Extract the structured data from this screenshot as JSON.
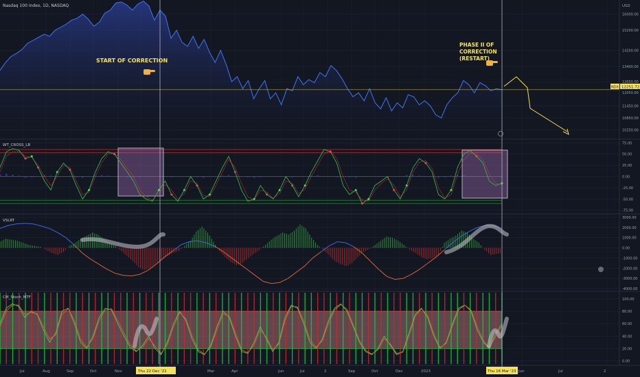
{
  "header": {
    "symbol_title": "Nasdaq 100 Index, 1D, NASDAQ",
    "currency": "USD"
  },
  "annotations": {
    "start": "START OF CORRECTION",
    "phase": [
      "PHASE II OF",
      "CORRECTION",
      "(RESTART)"
    ],
    "pointer_icon": "pointing-hand-icon"
  },
  "price_badge": {
    "ticker": "NDX",
    "value": "12251.72",
    "below": "12050.00"
  },
  "colors": {
    "bg": "#131722",
    "grid": "#1f2433",
    "price_line": "#3d6fe0",
    "price_fill_top": "#2c3f9a",
    "annotation": "#f5e25a",
    "wt_red": "#d23a3a",
    "wt_green": "#37b24d",
    "vslrt_green": "#2e9a3a",
    "vslrt_red": "#b02a2a",
    "stoch_band": "#c98a8a"
  },
  "panes": {
    "wt_title": "WT_CROSS_LB",
    "vslrt_title": "VSLRT",
    "stoch_title": "CM_Stoch_MTF"
  },
  "x_axis": {
    "labels": [
      "Jul",
      "Aug",
      "Sep",
      "Oct",
      "Nov",
      "Dec",
      "Mar",
      "Apr",
      "Jun",
      "Jul",
      "2",
      "Sep",
      "Oct",
      "Dec",
      "2023",
      "Jun",
      "Jul",
      "2"
    ],
    "cursor_left": "Thu 22 Dec '21",
    "cursor_right": "Thu 16 Mar '23"
  },
  "chart_data": [
    {
      "type": "area",
      "pane": "price",
      "y_ticks": [
        16000,
        15200,
        14200,
        13400,
        12650,
        11450,
        10850,
        10250
      ],
      "y_tick_labels": [
        "16000.00",
        "15200.00",
        "14200.00",
        "13400.00",
        "12650.00",
        "11450.00",
        "10850.00",
        "10250.00"
      ],
      "ylim": [
        9900,
        16700
      ],
      "hline": 12251.72,
      "series": [
        {
          "values": [
            13200,
            13600,
            13900,
            14050,
            14250,
            14550,
            14700,
            14850,
            15000,
            14900,
            15200,
            15350,
            15500,
            15700,
            15800,
            16000,
            15750,
            15400,
            15600,
            16050,
            16200,
            16550,
            16600,
            16450,
            16200,
            16500,
            16650,
            16400,
            15700,
            16200,
            15900,
            14800,
            15200,
            14600,
            14400,
            14900,
            14300,
            14750,
            14100,
            13600,
            14200,
            13500,
            12650,
            12900,
            12300,
            12700,
            11800,
            12300,
            12700,
            11800,
            12100,
            11500,
            12300,
            12200,
            12900,
            12500,
            12750,
            12600,
            13100,
            12900,
            13450,
            13200,
            12800,
            12300,
            11900,
            12100,
            11700,
            12300,
            11600,
            11300,
            11850,
            11200,
            11600,
            11350,
            12000,
            11900,
            11500,
            11700,
            11450,
            11000,
            10850,
            11500,
            11850,
            12100,
            12700,
            12500,
            12100,
            12600,
            12450,
            12200,
            12300,
            12251
          ]
        }
      ]
    },
    {
      "type": "line",
      "pane": "WT_CROSS_LB",
      "y_ticks": [
        75,
        50,
        25,
        0,
        -25,
        -50,
        -75
      ],
      "y_tick_labels": [
        "75.00",
        "50.00",
        "25.00",
        "0.00",
        "-25.00",
        "-50.00",
        "-75.00"
      ],
      "ylim": [
        -80,
        80
      ],
      "levels": [
        60,
        53,
        -53,
        -60
      ],
      "series": [
        {
          "values": [
            20,
            55,
            62,
            58,
            40,
            45,
            20,
            -10,
            -30,
            10,
            30,
            15,
            -20,
            -50,
            -30,
            10,
            40,
            55,
            50,
            30,
            10,
            -10,
            -40,
            -50,
            -55,
            -30,
            -10,
            -40,
            -55,
            -30,
            0,
            -20,
            -50,
            -40,
            -10,
            20,
            45,
            10,
            -30,
            -55,
            -50,
            -20,
            -40,
            -50,
            -30,
            0,
            -20,
            -45,
            -20,
            10,
            35,
            60,
            55,
            30,
            -20,
            -40,
            -30,
            -60,
            -50,
            -20,
            -10,
            0,
            -30,
            -50,
            -20,
            20,
            40,
            30,
            10,
            -40,
            -50,
            -30,
            20,
            50,
            58,
            45,
            30,
            -10,
            -20,
            -15
          ]
        },
        {
          "values": [
            10,
            45,
            55,
            55,
            45,
            42,
            25,
            0,
            -20,
            0,
            25,
            20,
            -10,
            -40,
            -35,
            0,
            30,
            50,
            52,
            38,
            18,
            0,
            -30,
            -45,
            -52,
            -38,
            -18,
            -30,
            -50,
            -38,
            -10,
            -15,
            -42,
            -45,
            -20,
            10,
            38,
            20,
            -15,
            -45,
            -52,
            -30,
            -35,
            -48,
            -38,
            -10,
            -15,
            -38,
            -28,
            0,
            25,
            50,
            58,
            40,
            0,
            -30,
            -35,
            -52,
            -55,
            -30,
            -15,
            -5,
            -20,
            -45,
            -30,
            10,
            32,
            35,
            18,
            -25,
            -48,
            -40,
            5,
            38,
            52,
            50,
            38,
            5,
            -15,
            -18
          ]
        }
      ],
      "histogram": [
        5,
        6,
        4,
        2,
        -3,
        -2,
        1,
        3,
        2,
        -1,
        0,
        1,
        -2,
        -3,
        -1,
        2,
        3,
        2,
        0,
        -1,
        -2,
        -3,
        -2,
        -1,
        0,
        1,
        -1,
        -2,
        0,
        1,
        -1,
        -2,
        -3,
        -1,
        0,
        2,
        3,
        1,
        0,
        -2,
        -3,
        -2,
        -1,
        0,
        1,
        -1,
        -2,
        -1,
        0,
        2,
        3,
        1,
        0,
        -2,
        -1,
        -2,
        -3,
        -1,
        0,
        1,
        0,
        -2,
        -1,
        1,
        3,
        4,
        2,
        0,
        -1,
        -3,
        -2,
        2,
        4,
        3,
        1,
        0,
        -1,
        -2,
        -1,
        0
      ]
    },
    {
      "type": "bar",
      "pane": "VSLRT",
      "y_ticks": [
        3000,
        2000,
        1000,
        0,
        -1000,
        -2000,
        -3000,
        -4000
      ],
      "y_tick_labels": [
        "3000.00",
        "2000.00",
        "1000.00",
        "0.00",
        "-1000.00",
        "-2000.00",
        "-3000.00",
        "-4000.00"
      ],
      "ylim": [
        -4200,
        3200
      ],
      "values": [
        600,
        900,
        800,
        700,
        500,
        300,
        200,
        100,
        -200,
        -500,
        -700,
        -400,
        200,
        500,
        900,
        1200,
        1500,
        1300,
        900,
        500,
        200,
        -300,
        -800,
        -1300,
        -1900,
        -2200,
        -2000,
        -1600,
        -1200,
        -800,
        -500,
        -300,
        200,
        700,
        1600,
        2100,
        1500,
        600,
        -300,
        -900,
        -1400,
        -1700,
        -1500,
        -1000,
        -600,
        -200,
        300,
        800,
        1200,
        1500,
        1300,
        1700,
        2300,
        1900,
        1000,
        300,
        -200,
        -700,
        -1300,
        -1600,
        -1800,
        -1500,
        -900,
        -400,
        -100,
        300,
        700,
        1100,
        1000,
        700,
        300,
        -200,
        -500,
        -900,
        -1100,
        -1000,
        -700,
        500,
        900,
        1200,
        1700,
        1500,
        900,
        500,
        -200,
        -700,
        -600,
        -500
      ],
      "signal": [
        1900,
        2200,
        2350,
        2400,
        2350,
        2150,
        1900,
        1500,
        1000,
        300,
        -500,
        -1100,
        -1600,
        -2100,
        -2500,
        -2700,
        -2750,
        -2600,
        -2200,
        -1600,
        -900,
        -300,
        300,
        600,
        700,
        500,
        200,
        -300,
        -900,
        -1500,
        -2100,
        -2700,
        -3300,
        -3500,
        -3400,
        -3000,
        -2400,
        -1800,
        -1000,
        -400,
        200,
        600,
        500,
        100,
        -500,
        -1300,
        -2100,
        -2800,
        -3100,
        -3000,
        -2600,
        -2100,
        -1500,
        -900,
        -200,
        500,
        1100,
        1600,
        2000,
        2200,
        2150,
        1900
      ]
    },
    {
      "type": "line",
      "pane": "CM_Stoch_MTF",
      "y_ticks": [
        100,
        80,
        60,
        40,
        20,
        0
      ],
      "y_tick_labels": [
        "100.00",
        "80.00",
        "60.00",
        "40.00",
        "20.00",
        "0.00"
      ],
      "ylim": [
        -5,
        110
      ],
      "band": [
        20,
        80
      ],
      "series": [
        {
          "values": [
            60,
            85,
            92,
            88,
            70,
            80,
            75,
            50,
            30,
            45,
            80,
            85,
            60,
            30,
            20,
            40,
            70,
            85,
            82,
            60,
            40,
            22,
            15,
            25,
            40,
            20,
            10,
            30,
            60,
            80,
            65,
            35,
            15,
            10,
            25,
            55,
            80,
            70,
            40,
            15,
            12,
            30,
            55,
            35,
            15,
            30,
            70,
            90,
            85,
            60,
            30,
            20,
            35,
            65,
            85,
            92,
            80,
            55,
            30,
            15,
            10,
            20,
            40,
            25,
            10,
            15,
            45,
            75,
            85,
            70,
            40,
            20,
            30,
            60,
            85,
            90,
            80,
            50,
            30,
            20,
            45,
            60
          ]
        },
        {
          "values": [
            55,
            80,
            90,
            90,
            75,
            78,
            76,
            55,
            35,
            42,
            75,
            84,
            65,
            35,
            22,
            36,
            65,
            82,
            84,
            65,
            45,
            26,
            16,
            22,
            36,
            24,
            12,
            26,
            55,
            78,
            68,
            40,
            18,
            11,
            22,
            50,
            76,
            72,
            45,
            18,
            13,
            26,
            50,
            38,
            18,
            27,
            65,
            88,
            87,
            65,
            35,
            22,
            32,
            60,
            82,
            91,
            83,
            58,
            33,
            17,
            11,
            18,
            36,
            27,
            12,
            14,
            40,
            72,
            84,
            73,
            44,
            22,
            28,
            56,
            82,
            90,
            82,
            55,
            33,
            21,
            40,
            57
          ]
        }
      ],
      "signal_bars": [
        1,
        0,
        1,
        0,
        1,
        0,
        0,
        1,
        0,
        1,
        0,
        0,
        1,
        0,
        1,
        0,
        1,
        1,
        0,
        0,
        1,
        0,
        1,
        0,
        0,
        1,
        1,
        0,
        1,
        0,
        0,
        1,
        0,
        1,
        0,
        1,
        1,
        0,
        1,
        0,
        0,
        1,
        1,
        0,
        1,
        0,
        1,
        0,
        1,
        1,
        0,
        0,
        1,
        0,
        1,
        0,
        1,
        1,
        0,
        1,
        0,
        1,
        0,
        0,
        1,
        1,
        0,
        1,
        0,
        1,
        0,
        1,
        1,
        0,
        1,
        0,
        1,
        1,
        0,
        1
      ]
    }
  ]
}
